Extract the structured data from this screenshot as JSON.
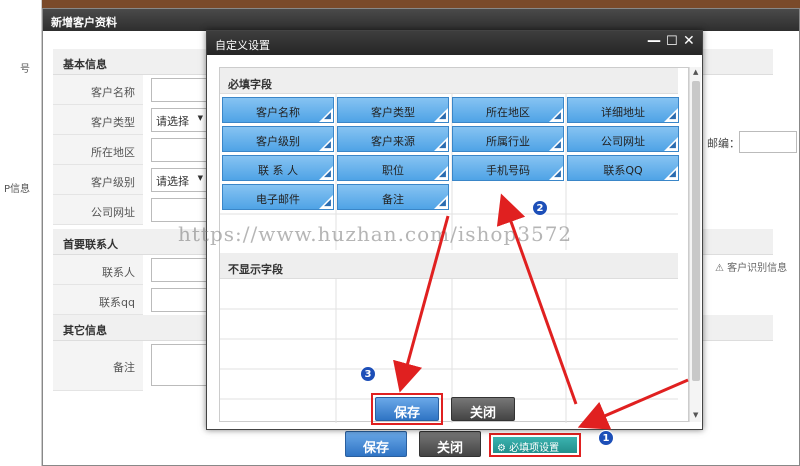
{
  "bg_dialog": {
    "title": "新增客户资料",
    "sections": {
      "basic": "基本信息",
      "contact": "首要联系人",
      "other": "其它信息"
    },
    "fields": {
      "customer_name": "客户名称",
      "customer_type": "客户类型",
      "region": "所在地区",
      "customer_level": "客户级别",
      "company_site": "公司网址",
      "contact": "联系人",
      "contact_qq": "联系qq",
      "remark": "备注",
      "select_placeholder": "请选择",
      "postcode": "邮编："
    },
    "notice": "⚠ 客户识别信息",
    "save": "保存",
    "close": "关闭",
    "required_settings": "必填项设置",
    "left_fragments": [
      "号",
      "P信息"
    ]
  },
  "modal": {
    "title": "自定义设置",
    "required_header": "必填字段",
    "hidden_header": "不显示字段",
    "required_fields": [
      "客户名称",
      "客户类型",
      "所在地区",
      "详细地址",
      "客户级别",
      "客户来源",
      "所属行业",
      "公司网址",
      "联 系 人",
      "职位",
      "手机号码",
      "联系QQ",
      "电子邮件",
      "备注"
    ],
    "save": "保存",
    "close": "关闭"
  },
  "watermark": "https://www.huzhan.com/ishop3572",
  "badges": [
    "1",
    "2",
    "3"
  ],
  "colors": {
    "chip": "#4fa3e6",
    "arrow": "#e02020",
    "badge": "#1d4fb8"
  }
}
